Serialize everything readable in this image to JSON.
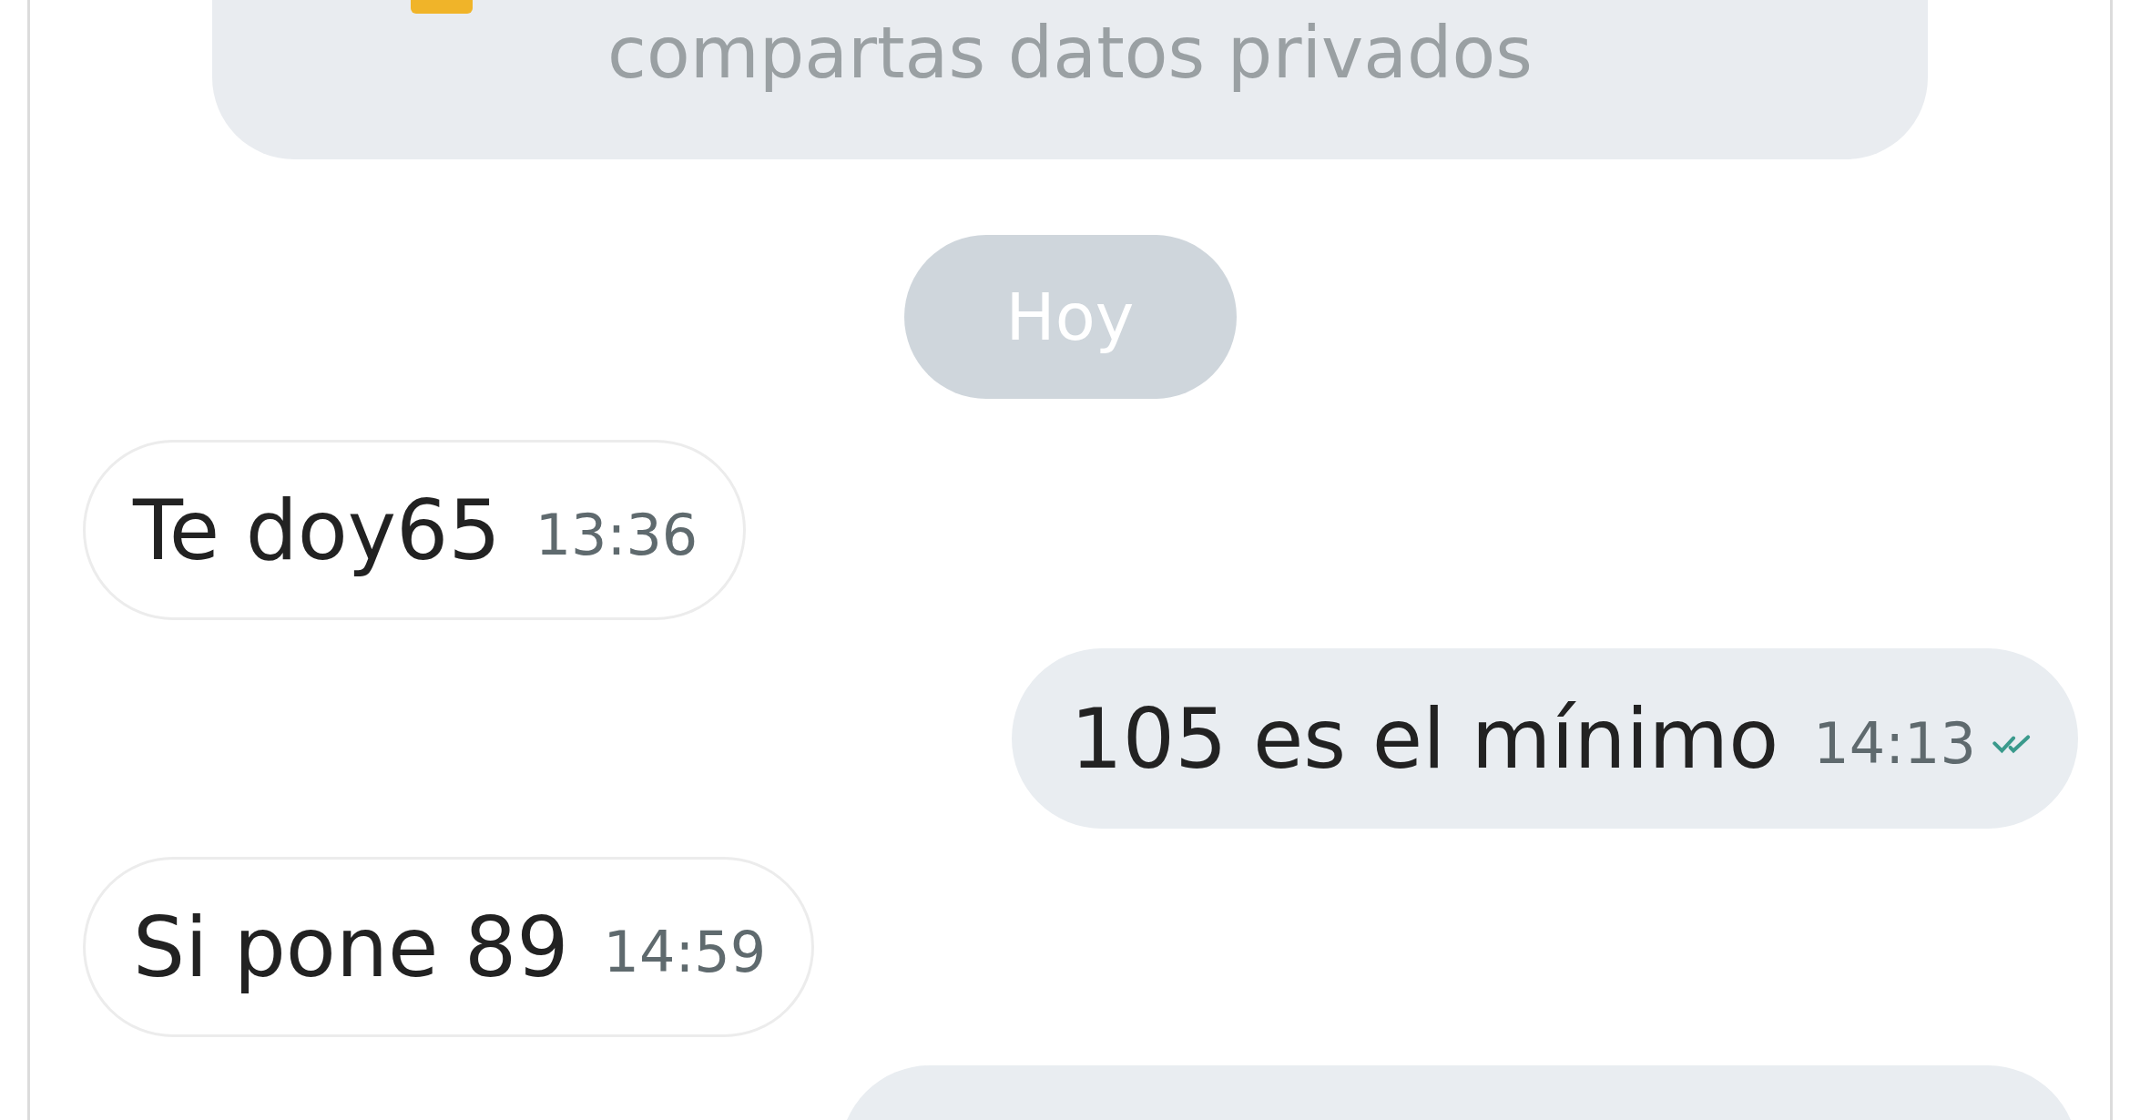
{
  "notice": {
    "text": "compartas datos privados"
  },
  "date_divider": "Hoy",
  "messages": [
    {
      "kind": "incoming",
      "text": "Te doy65",
      "time": "13:36"
    },
    {
      "kind": "outgoing",
      "text": "105 es el mínimo",
      "time": "14:13",
      "read": true
    },
    {
      "kind": "incoming",
      "text": "Si pone 89",
      "time": "14:59"
    },
    {
      "kind": "outgoing"
    }
  ]
}
